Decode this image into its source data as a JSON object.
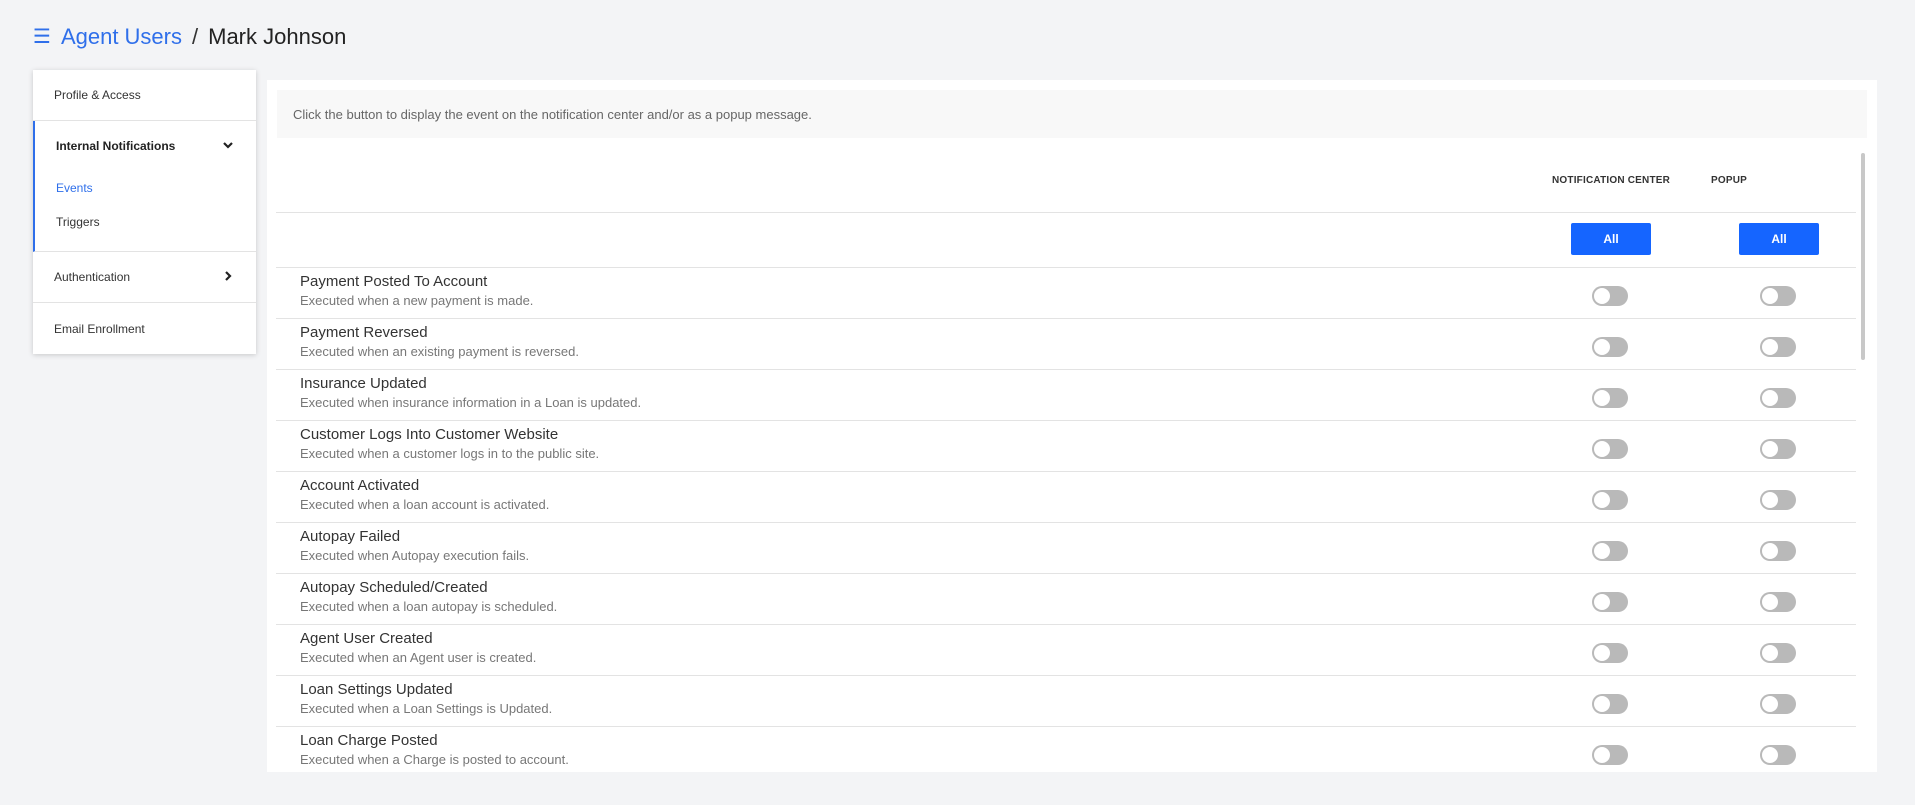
{
  "header": {
    "menu_icon": "hamburger-icon",
    "breadcrumb_parent": "Agent Users",
    "breadcrumb_sep": "/",
    "breadcrumb_current": "Mark Johnson"
  },
  "sidebar": {
    "profile_access": "Profile & Access",
    "internal_notifications": "Internal Notifications",
    "events": "Events",
    "triggers": "Triggers",
    "authentication": "Authentication",
    "email_enrollment": "Email Enrollment"
  },
  "panel": {
    "hint": "Click the button to display the event on the notification center and/or as a popup message.",
    "col_notification_center": "NOTIFICATION CENTER",
    "col_popup": "POPUP",
    "all_label": "All"
  },
  "events": [
    {
      "name": "Payment Posted To Account",
      "desc": "Executed when a new payment is made."
    },
    {
      "name": "Payment Reversed",
      "desc": "Executed when an existing payment is reversed."
    },
    {
      "name": "Insurance Updated",
      "desc": "Executed when insurance information in a Loan is updated."
    },
    {
      "name": "Customer Logs Into Customer Website",
      "desc": "Executed when a customer logs in to the public site."
    },
    {
      "name": "Account Activated",
      "desc": "Executed when a loan account is activated."
    },
    {
      "name": "Autopay Failed",
      "desc": "Executed when Autopay execution fails."
    },
    {
      "name": "Autopay Scheduled/Created",
      "desc": "Executed when a loan autopay is scheduled."
    },
    {
      "name": "Agent User Created",
      "desc": "Executed when an Agent user is created."
    },
    {
      "name": "Loan Settings Updated",
      "desc": "Executed when a Loan Settings is Updated."
    },
    {
      "name": "Loan Charge Posted",
      "desc": "Executed when a Charge is posted to account."
    }
  ],
  "colors": {
    "accent": "#2f6fea",
    "button": "#1565ff",
    "toggle_off": "#b9b9b9"
  }
}
